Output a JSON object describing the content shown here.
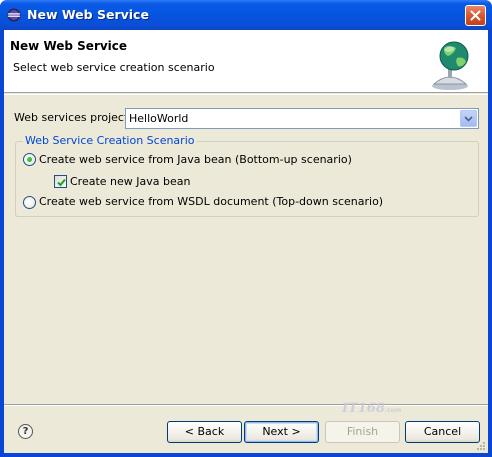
{
  "window": {
    "title": "New Web Service"
  },
  "banner": {
    "title": "New Web Service",
    "description": "Select web service creation scenario",
    "graphic_icon": "web-service-globe-icon"
  },
  "project": {
    "label": "Web services project:",
    "value": "HelloWorld"
  },
  "scenario_group": {
    "legend": "Web Service Creation Scenario",
    "options": [
      {
        "label": "Create web service from Java bean (Bottom-up scenario)",
        "selected": true
      },
      {
        "label": "Create web service from WSDL document (Top-down scenario)",
        "selected": false
      }
    ],
    "checkbox": {
      "label": "Create new Java bean",
      "checked": true
    }
  },
  "footer": {
    "help_label": "?",
    "buttons": {
      "back": "< Back",
      "next": "Next >",
      "finish": "Finish",
      "cancel": "Cancel"
    },
    "finish_enabled": false,
    "default_button": "next"
  },
  "watermark": {
    "text": "IT168",
    "small": ".com"
  },
  "colors": {
    "titlebar": "#0556e0",
    "dialog_background": "#ece9d8",
    "group_legend": "#0046d5",
    "button_border": "#003c74"
  }
}
